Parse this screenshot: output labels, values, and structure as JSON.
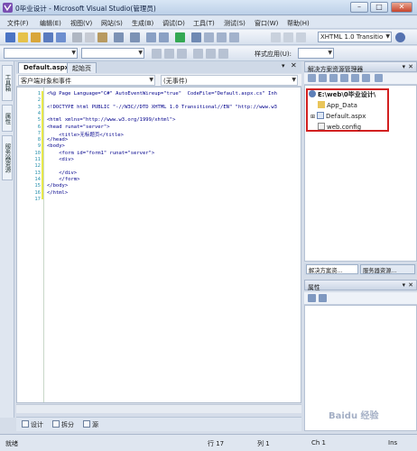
{
  "window": {
    "title": "0毕业设计 - Microsoft Visual Studio(管理员)",
    "minimize": "–",
    "maximize": "□",
    "close": "✕"
  },
  "menu": [
    "文件(F)",
    "编辑(E)",
    "视图(V)",
    "网站(S)",
    "生成(B)",
    "调试(D)",
    "工具(T)",
    "测试(S)",
    "窗口(W)",
    "帮助(H)"
  ],
  "toolbar": {
    "doctype": "XHTML 1.0 Transitio",
    "style_apply": "样式应用(U):"
  },
  "left_strip": [
    "工具箱",
    "属性",
    "服务器资源"
  ],
  "tabs": [
    {
      "label": "Default.aspx",
      "active": true
    },
    {
      "label": "起始页",
      "active": false
    }
  ],
  "editor_nav": {
    "left": "客户端对象和事件",
    "right": "(无事件)"
  },
  "code": {
    "line_numbers": [
      "1",
      "2",
      "3",
      "4",
      "5",
      "6",
      "7",
      "8",
      "9",
      "10",
      "11",
      "12",
      "13",
      "14",
      "15",
      "16",
      "17"
    ],
    "lines": [
      "<%@ Page Language=\"C#\" AutoEventWireup=\"true\"  CodeFile=\"Default.aspx.cs\" Inh",
      "",
      "<!DOCTYPE html PUBLIC \"-//W3C//DTD XHTML 1.0 Transitional//EN\" \"http://www.w3",
      "",
      "<html xmlns=\"http://www.w3.org/1999/xhtml\">",
      "<head runat=\"server\">",
      "    <title>无标题页</title>",
      "</head>",
      "<body>",
      "    <form id=\"form1\" runat=\"server\">",
      "    <div>",
      "",
      "    </div>",
      "    </form>",
      "</body>",
      "</html>",
      ""
    ]
  },
  "view_buttons": [
    "设计",
    "拆分",
    "源"
  ],
  "solution_explorer": {
    "title": "解决方案资源管理器",
    "root": "E:\\web\\0毕业设计\\",
    "items": [
      "App_Data",
      "Default.aspx",
      "web.config"
    ],
    "tabs": [
      "解决方案资...",
      "服务器资源..."
    ]
  },
  "properties": {
    "title": "属性"
  },
  "status": {
    "ready": "就绪",
    "row": "行 17",
    "col": "列 1",
    "ch": "Ch 1",
    "ins": "Ins"
  },
  "watermark": "Baidu 经验",
  "colors": {
    "highlight": "#d22020",
    "keyword": "#00008b",
    "line_number": "#2b91af"
  }
}
